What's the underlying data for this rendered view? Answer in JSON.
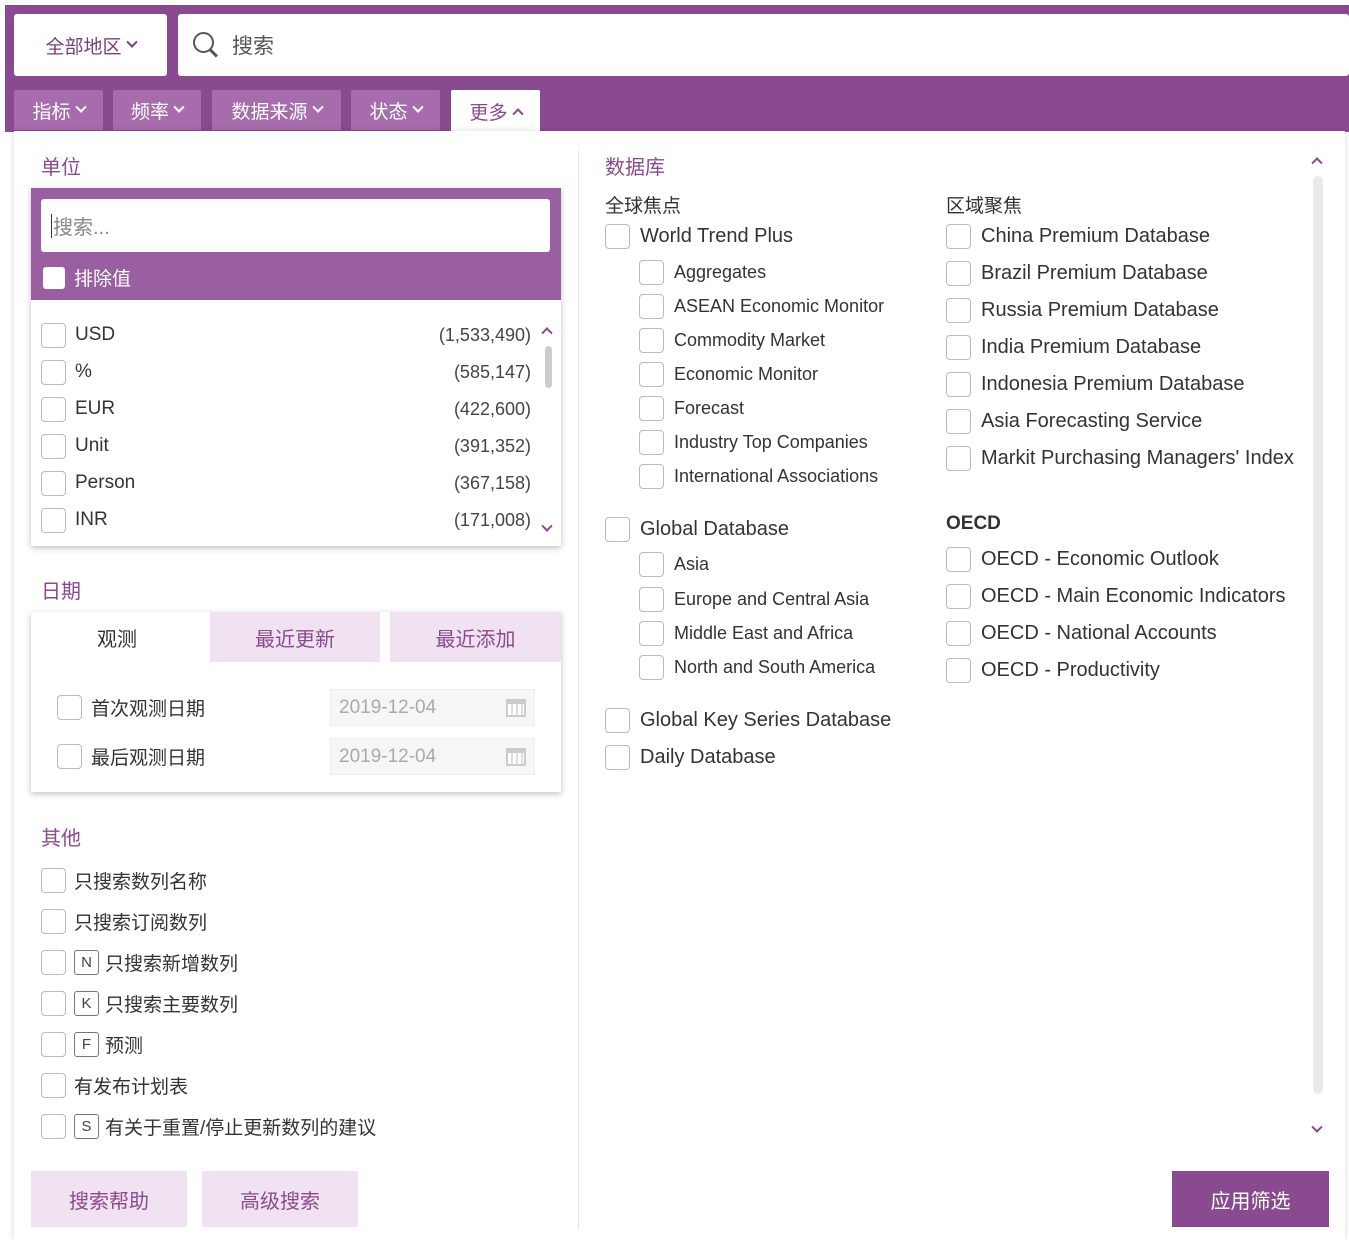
{
  "header": {
    "region_label": "全部地区",
    "search_placeholder": "搜索"
  },
  "tabs": [
    {
      "label": "指标"
    },
    {
      "label": "频率"
    },
    {
      "label": "数据来源"
    },
    {
      "label": "状态"
    },
    {
      "label": "更多"
    }
  ],
  "unit": {
    "title": "单位",
    "search_placeholder": "搜索...",
    "exclude_label": "排除值",
    "items": [
      {
        "label": "USD",
        "count": "(1,533,490)"
      },
      {
        "label": "%",
        "count": "(585,147)"
      },
      {
        "label": "EUR",
        "count": "(422,600)"
      },
      {
        "label": "Unit",
        "count": "(391,352)"
      },
      {
        "label": "Person",
        "count": "(367,158)"
      },
      {
        "label": "INR",
        "count": "(171,008)"
      }
    ]
  },
  "date": {
    "title": "日期",
    "tabs": [
      "观测",
      "最近更新",
      "最近添加"
    ],
    "first_obs_label": "首次观测日期",
    "first_obs_value": "2019-12-04",
    "last_obs_label": "最后观测日期",
    "last_obs_value": "2019-12-04"
  },
  "other": {
    "title": "其他",
    "items": [
      {
        "tag": "",
        "label": "只搜索数列名称"
      },
      {
        "tag": "",
        "label": "只搜索订阅数列"
      },
      {
        "tag": "N",
        "label": "只搜索新增数列"
      },
      {
        "tag": "K",
        "label": "只搜索主要数列"
      },
      {
        "tag": "F",
        "label": "预测"
      },
      {
        "tag": "",
        "label": "有发布计划表"
      },
      {
        "tag": "S",
        "label": "有关于重置/停止更新数列的建议"
      }
    ]
  },
  "database": {
    "title": "数据库",
    "global_focus": "全球焦点",
    "regional_focus": "区域聚焦",
    "world_trend_plus": "World Trend Plus",
    "wtp_children": [
      "Aggregates",
      "ASEAN Economic Monitor",
      "Commodity Market",
      "Economic Monitor",
      "Forecast",
      "Industry Top Companies",
      "International Associations"
    ],
    "global_database": "Global Database",
    "gd_children": [
      "Asia",
      "Europe and Central Asia",
      "Middle East and Africa",
      "North and South America"
    ],
    "global_key_series": "Global Key Series Database",
    "daily_database": "Daily Database",
    "regional_items": [
      "China Premium Database",
      "Brazil Premium Database",
      "Russia Premium Database",
      "India Premium Database",
      "Indonesia Premium Database",
      "Asia Forecasting Service",
      "Markit Purchasing Managers' Index"
    ],
    "oecd_title": "OECD",
    "oecd_items": [
      "OECD - Economic Outlook",
      "OECD - Main Economic Indicators",
      "OECD - National Accounts",
      "OECD - Productivity"
    ]
  },
  "buttons": {
    "search_help": "搜索帮助",
    "advanced_search": "高级搜索",
    "apply_filter": "应用筛选"
  },
  "colors": {
    "brand": "#8a4a8f",
    "tab": "#a66cab",
    "light": "#f0e2f1"
  }
}
